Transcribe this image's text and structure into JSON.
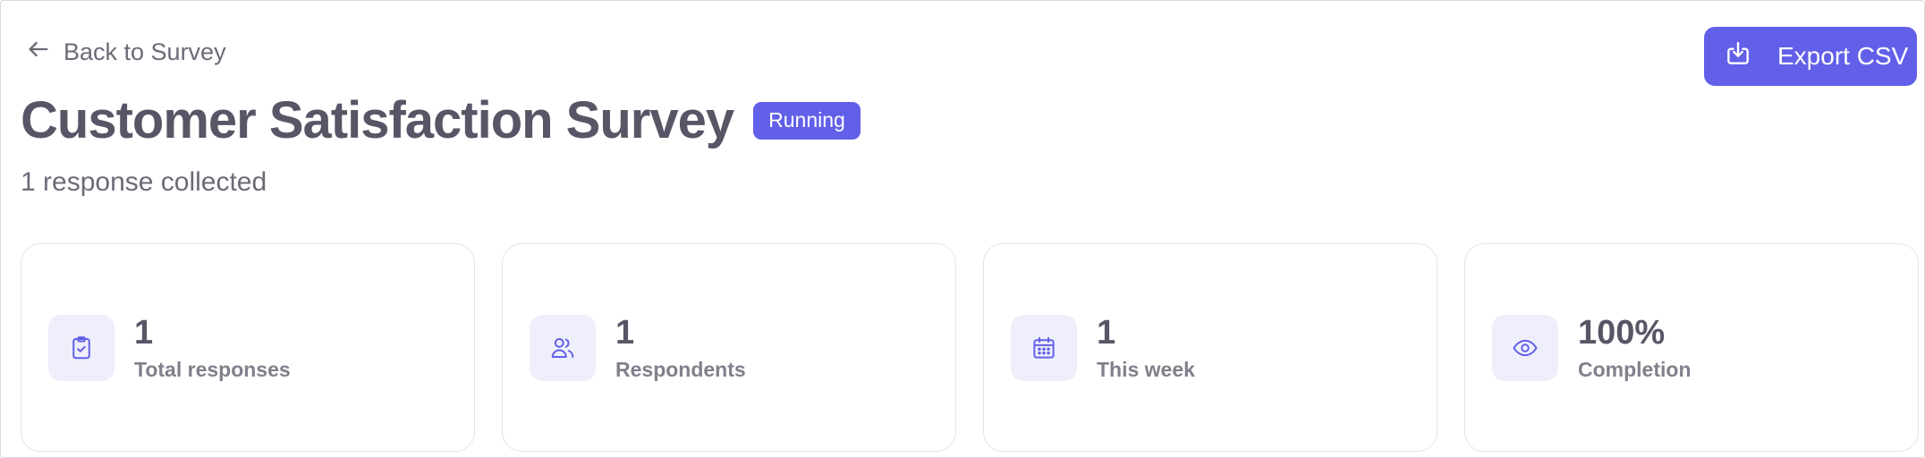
{
  "nav": {
    "back_label": "Back to Survey",
    "back_icon": "arrow-left-icon"
  },
  "toolbar": {
    "export_label": "Export CSV",
    "export_icon": "download-icon"
  },
  "header": {
    "title": "Customer Satisfaction Survey",
    "status": "Running",
    "subtitle": "1 response collected"
  },
  "stats": [
    {
      "value": "1",
      "label": "Total responses",
      "icon": "clipboard-check-icon"
    },
    {
      "value": "1",
      "label": "Respondents",
      "icon": "users-icon"
    },
    {
      "value": "1",
      "label": "This week",
      "icon": "calendar-icon"
    },
    {
      "value": "100%",
      "label": "Completion",
      "icon": "eye-icon"
    }
  ],
  "colors": {
    "accent": "#6260e8",
    "icon_bg": "#efeffc",
    "text_primary": "#565666",
    "text_secondary": "#6b6b78"
  }
}
